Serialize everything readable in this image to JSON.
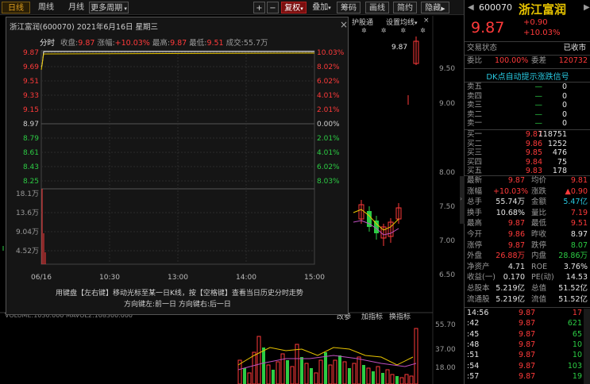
{
  "toolbar": {
    "period_tabs": [
      "日线",
      "周线",
      "月线",
      "更多周期"
    ],
    "plus": "+",
    "minus": "−",
    "restore": "复权",
    "overlay": "叠加",
    "chips": "筹码",
    "draw": "画线",
    "brief": "简约",
    "hide_ind": "隐藏",
    "hide_arrow": "▶"
  },
  "sub_indicators": {
    "shares": "护股通",
    "settings": "设置均线"
  },
  "kline": {
    "label": "9.87",
    "y_ticks": [
      "9.50",
      "9.00",
      "8.00",
      "7.50",
      "7.00",
      "6.50"
    ],
    "vol_ticks": [
      "55.70",
      "37.00",
      "18.00"
    ]
  },
  "vol_bar_labels": [
    "改参",
    "加指标",
    "换指标"
  ],
  "vol_text": "VOLUME:1030.000 MAVOL2:108300.000",
  "popup": {
    "title": "浙江富润(600070) 2021年6月16日 星期三",
    "close": "×",
    "info": {
      "label": "分时",
      "close_label": "收盘:",
      "close": "9.87",
      "change_label": "涨幅:",
      "change": "+10.03%",
      "high_label": "最高:",
      "high": "9.87",
      "low_label": "最低:",
      "low": "9.51",
      "vol_label": "成交:",
      "vol": "55.7万"
    },
    "price_ticks": [
      "9.87",
      "9.69",
      "9.51",
      "9.33",
      "9.15",
      "8.97",
      "8.79",
      "8.61",
      "8.43",
      "8.25"
    ],
    "pct_ticks": [
      "10.03%",
      "8.02%",
      "6.02%",
      "4.01%",
      "2.01%",
      "0.00%",
      "2.01%",
      "4.01%",
      "6.02%",
      "8.03%"
    ],
    "vol_ticks": [
      "18.1万",
      "13.6万",
      "9.04万",
      "4.52万"
    ],
    "time_ticks": [
      "06/16",
      "10:30",
      "13:00",
      "14:00",
      "15:00"
    ],
    "hint1": "用键盘【左右键】移动光标至某一日K线，按【空格键】查看当日历史分时走势",
    "hint2": "方向键左:前一日  方向键右:后一日"
  },
  "panel": {
    "code": "600070",
    "name": "浙江富润",
    "price": "9.87",
    "change": "+0.90",
    "change_pct": "+10.03%",
    "status_label": "交易状态",
    "status": "已收市",
    "ratio_label": "委比",
    "ratio": "100.00%",
    "diff_label": "委差",
    "diff": "120732",
    "signal": "DK点自动提示涨跌信号",
    "asks": [
      {
        "l": "卖五",
        "p": "—",
        "v": "0"
      },
      {
        "l": "卖四",
        "p": "—",
        "v": "0"
      },
      {
        "l": "卖三",
        "p": "—",
        "v": "0"
      },
      {
        "l": "卖二",
        "p": "—",
        "v": "0"
      },
      {
        "l": "卖一",
        "p": "—",
        "v": "0"
      }
    ],
    "bids": [
      {
        "l": "买一",
        "p": "9.87",
        "v": "118751"
      },
      {
        "l": "买二",
        "p": "9.86",
        "v": "1252"
      },
      {
        "l": "买三",
        "p": "9.85",
        "v": "476"
      },
      {
        "l": "买四",
        "p": "9.84",
        "v": "75"
      },
      {
        "l": "买五",
        "p": "9.83",
        "v": "178"
      }
    ],
    "stats": [
      {
        "l1": "最新",
        "v1": "9.87",
        "c1": "r",
        "l2": "均价",
        "v2": "9.81",
        "c2": "r"
      },
      {
        "l1": "涨幅",
        "v1": "+10.03%",
        "c1": "r",
        "l2": "涨跌",
        "v2": "▲0.90",
        "c2": "r"
      },
      {
        "l1": "总手",
        "v1": "55.74万",
        "c1": "w",
        "l2": "金额",
        "v2": "5.47亿",
        "c2": "c"
      },
      {
        "l1": "换手",
        "v1": "10.68%",
        "c1": "w",
        "l2": "量比",
        "v2": "7.19",
        "c2": "r"
      },
      {
        "l1": "最高",
        "v1": "9.87",
        "c1": "r",
        "l2": "最低",
        "v2": "9.51",
        "c2": "r"
      },
      {
        "l1": "今开",
        "v1": "9.86",
        "c1": "r",
        "l2": "昨收",
        "v2": "8.97",
        "c2": "w"
      },
      {
        "l1": "涨停",
        "v1": "9.87",
        "c1": "r",
        "l2": "跌停",
        "v2": "8.07",
        "c2": "g"
      },
      {
        "l1": "外盘",
        "v1": "26.88万",
        "c1": "r",
        "l2": "内盘",
        "v2": "28.86万",
        "c2": "g"
      },
      {
        "l1": "净资产",
        "v1": "4.71",
        "c1": "w",
        "l2": "ROE",
        "v2": "3.76%",
        "c2": "w"
      },
      {
        "l1": "收益(一)",
        "v1": "0.170",
        "c1": "w",
        "l2": "PE(动)",
        "v2": "14.53",
        "c2": "w"
      },
      {
        "l1": "总股本",
        "v1": "5.219亿",
        "c1": "w",
        "l2": "总值",
        "v2": "51.52亿",
        "c2": "w"
      },
      {
        "l1": "流通股",
        "v1": "5.219亿",
        "c1": "w",
        "l2": "流值",
        "v2": "51.52亿",
        "c2": "w"
      }
    ],
    "ticks": [
      {
        "t": "14:56",
        "p": "9.87",
        "v": "17",
        "c": "r"
      },
      {
        "t": ":42",
        "p": "9.87",
        "v": "621",
        "c": "g"
      },
      {
        "t": ":45",
        "p": "9.87",
        "v": "65",
        "c": "g"
      },
      {
        "t": ":48",
        "p": "9.87",
        "v": "10",
        "c": "g"
      },
      {
        "t": ":51",
        "p": "9.87",
        "v": "10",
        "c": "g"
      },
      {
        "t": ":54",
        "p": "9.87",
        "v": "103",
        "c": "g"
      },
      {
        "t": ":57",
        "p": "9.87",
        "v": "19",
        "c": "g"
      }
    ]
  },
  "colors": {
    "up": "#ff3a3a",
    "down": "#2ccc44",
    "price_line": "#ffffff",
    "avg_line": "#e8c400"
  }
}
